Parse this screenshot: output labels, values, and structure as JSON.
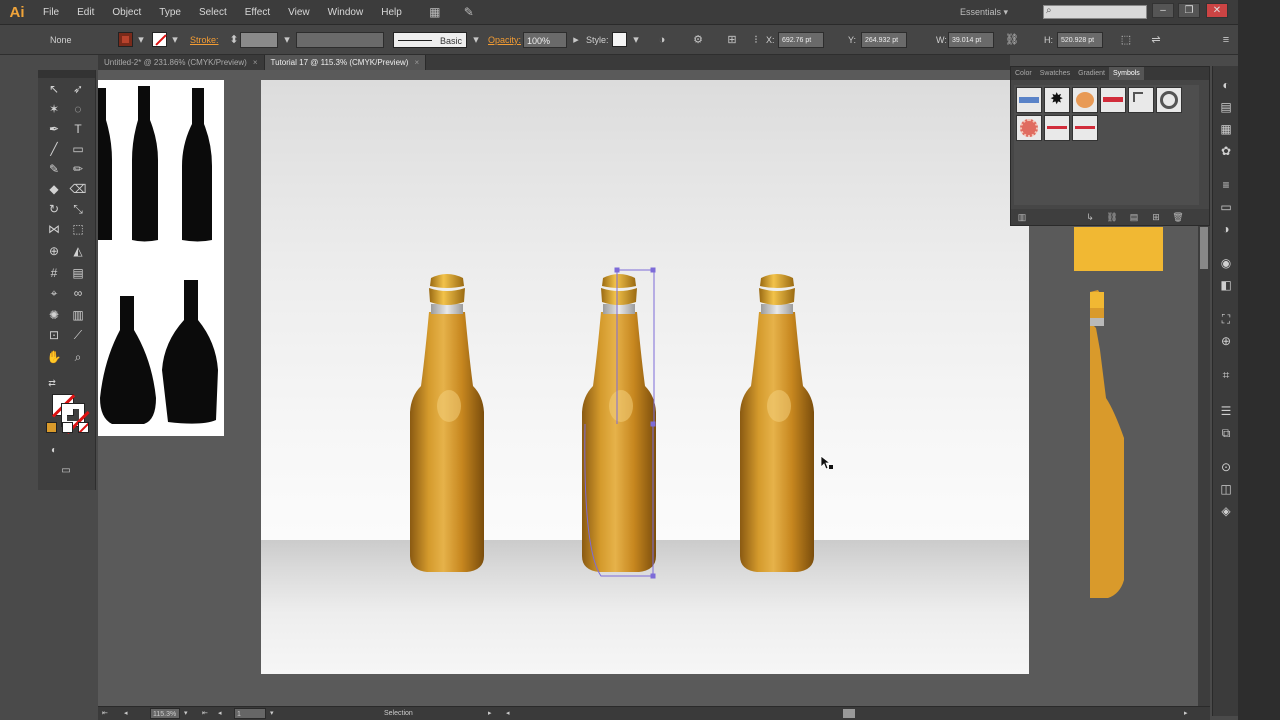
{
  "app": {
    "logo": "Ai"
  },
  "menu": {
    "items": [
      "File",
      "Edit",
      "Object",
      "Type",
      "Select",
      "Effect",
      "View",
      "Window",
      "Help"
    ],
    "workspace": "Essentials",
    "search_placeholder": ""
  },
  "control_bar": {
    "selection_label": "None",
    "stroke_label": "Stroke:",
    "brush_label": "Basic",
    "opacity_label": "Opacity:",
    "opacity_value": "100%",
    "style_label": "Style:",
    "x_value": "692.76 pt",
    "y_value": "264.932 pt",
    "w_value": "39.014 pt",
    "h_value": "520.928 pt"
  },
  "doc_tabs": [
    {
      "label": "Untitled-2* @ 231.86% (CMYK/Preview)",
      "active": false
    },
    {
      "label": "Tutorial 17 @ 115.3% (CMYK/Preview)",
      "active": true
    }
  ],
  "symbols_panel": {
    "tabs": [
      "Color",
      "Swatches",
      "Gradient",
      "Symbols"
    ],
    "active_tab": "Symbols"
  },
  "status_bar": {
    "zoom": "115.3%",
    "page": "1",
    "tool": "Selection"
  },
  "colors": {
    "bottle_gold": "#c9902a",
    "accent_orange": "#f39c33",
    "symbol_swatch": "#f1b833"
  }
}
